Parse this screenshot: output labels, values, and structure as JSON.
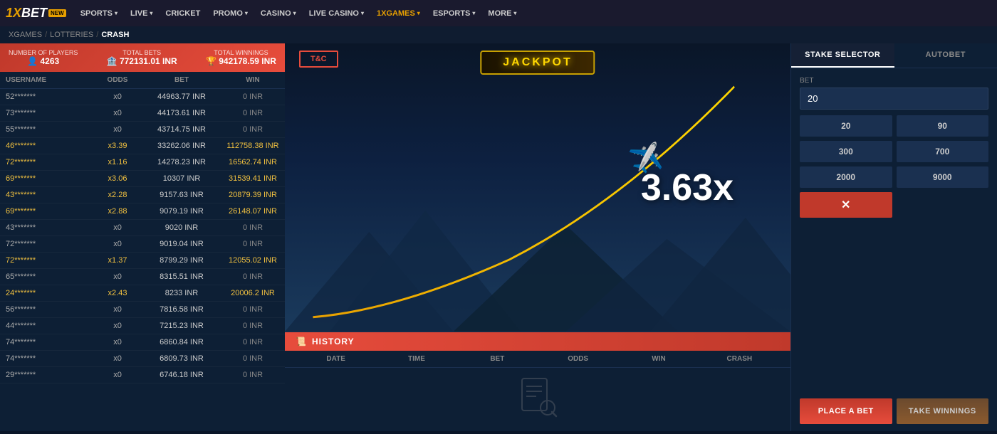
{
  "navbar": {
    "logo": "1XBET",
    "new_badge": "NEW",
    "items": [
      {
        "label": "SPORTS",
        "has_dropdown": true,
        "active": false
      },
      {
        "label": "LIVE",
        "has_dropdown": true,
        "active": false
      },
      {
        "label": "CRICKET",
        "has_dropdown": false,
        "active": false
      },
      {
        "label": "PROMO",
        "has_dropdown": true,
        "active": false
      },
      {
        "label": "CASINO",
        "has_dropdown": true,
        "active": false
      },
      {
        "label": "LIVE CASINO",
        "has_dropdown": true,
        "active": false
      },
      {
        "label": "1XGAMES",
        "has_dropdown": true,
        "active": true
      },
      {
        "label": "ESPORTS",
        "has_dropdown": true,
        "active": false
      },
      {
        "label": "MORE",
        "has_dropdown": true,
        "active": false
      }
    ]
  },
  "breadcrumb": {
    "items": [
      "XGAMES",
      "LOTTERIES",
      "CRASH"
    ]
  },
  "stats": {
    "players_label": "Number of players",
    "players_value": "4263",
    "total_bets_label": "Total bets",
    "total_bets_value": "772131.01 INR",
    "total_winnings_label": "Total winnings",
    "total_winnings_value": "942178.59 INR"
  },
  "table": {
    "columns": [
      "USERNAME",
      "ODDS",
      "BET",
      "WIN"
    ],
    "rows": [
      {
        "user": "52*******",
        "odds": "x0",
        "bet": "44963.77 INR",
        "win": "0 INR",
        "winner": false
      },
      {
        "user": "73*******",
        "odds": "x0",
        "bet": "44173.61 INR",
        "win": "0 INR",
        "winner": false
      },
      {
        "user": "55*******",
        "odds": "x0",
        "bet": "43714.75 INR",
        "win": "0 INR",
        "winner": false
      },
      {
        "user": "46*******",
        "odds": "x3.39",
        "bet": "33262.06 INR",
        "win": "112758.38 INR",
        "winner": true
      },
      {
        "user": "72*******",
        "odds": "x1.16",
        "bet": "14278.23 INR",
        "win": "16562.74 INR",
        "winner": true
      },
      {
        "user": "69*******",
        "odds": "x3.06",
        "bet": "10307 INR",
        "win": "31539.41 INR",
        "winner": true
      },
      {
        "user": "43*******",
        "odds": "x2.28",
        "bet": "9157.63 INR",
        "win": "20879.39 INR",
        "winner": true
      },
      {
        "user": "69*******",
        "odds": "x2.88",
        "bet": "9079.19 INR",
        "win": "26148.07 INR",
        "winner": true
      },
      {
        "user": "43*******",
        "odds": "x0",
        "bet": "9020 INR",
        "win": "0 INR",
        "winner": false
      },
      {
        "user": "72*******",
        "odds": "x0",
        "bet": "9019.04 INR",
        "win": "0 INR",
        "winner": false
      },
      {
        "user": "72*******",
        "odds": "x1.37",
        "bet": "8799.29 INR",
        "win": "12055.02 INR",
        "winner": true
      },
      {
        "user": "65*******",
        "odds": "x0",
        "bet": "8315.51 INR",
        "win": "0 INR",
        "winner": false
      },
      {
        "user": "24*******",
        "odds": "x2.43",
        "bet": "8233 INR",
        "win": "20006.2 INR",
        "winner": true
      },
      {
        "user": "56*******",
        "odds": "x0",
        "bet": "7816.58 INR",
        "win": "0 INR",
        "winner": false
      },
      {
        "user": "44*******",
        "odds": "x0",
        "bet": "7215.23 INR",
        "win": "0 INR",
        "winner": false
      },
      {
        "user": "74*******",
        "odds": "x0",
        "bet": "6860.84 INR",
        "win": "0 INR",
        "winner": false
      },
      {
        "user": "74*******",
        "odds": "x0",
        "bet": "6809.73 INR",
        "win": "0 INR",
        "winner": false
      },
      {
        "user": "29*******",
        "odds": "x0",
        "bet": "6746.18 INR",
        "win": "0 INR",
        "winner": false
      }
    ]
  },
  "jackpot": {
    "label": "JACKPOT"
  },
  "tc_button": "T&C",
  "multiplier": "3.63x",
  "history": {
    "title": "HISTORY",
    "columns": [
      "DATE",
      "TIME",
      "BET",
      "ODDS",
      "WIN",
      "CRASH"
    ],
    "empty_icon": "📋"
  },
  "stake": {
    "selector_label": "STAKE SELECTOR",
    "autobet_label": "AUTOBET",
    "bet_label": "Bet",
    "bet_value": "20",
    "quick_amounts": [
      "20",
      "90",
      "300",
      "700",
      "2000",
      "9000"
    ],
    "clear_label": "✕",
    "place_bet_label": "PLACE A BET",
    "take_winnings_label": "TAKE WINNINGS"
  }
}
